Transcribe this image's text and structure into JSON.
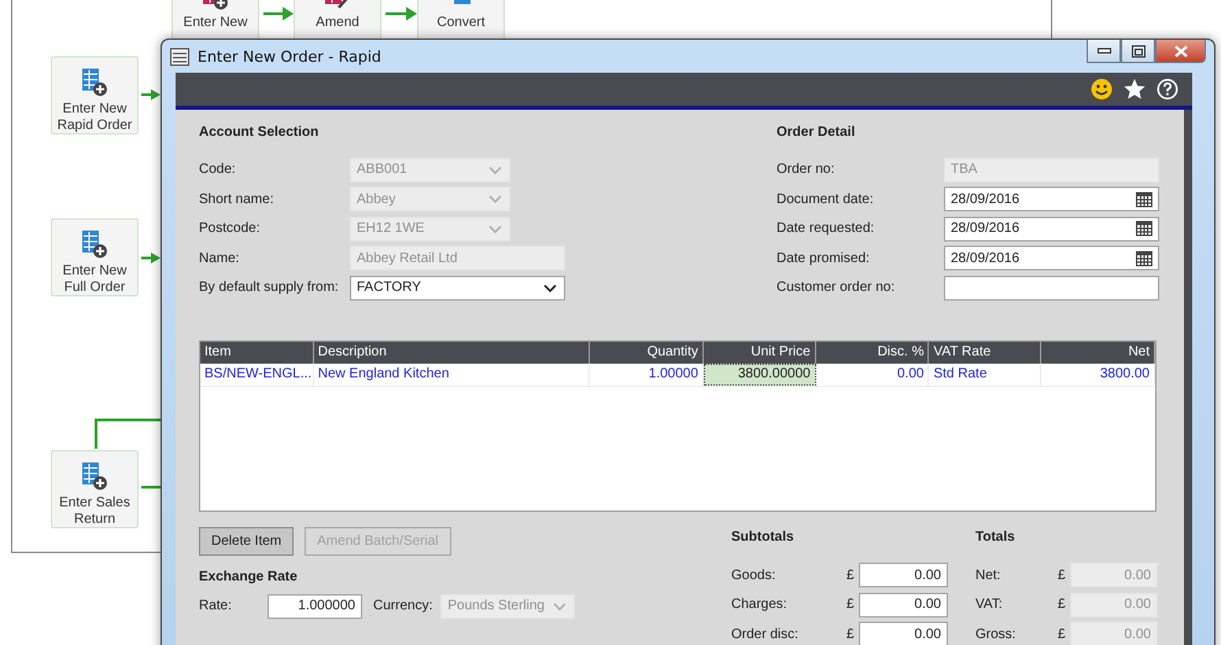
{
  "workflow": {
    "nodes": [
      {
        "label": "Enter New"
      },
      {
        "label": "Amend"
      },
      {
        "label": "Convert"
      },
      {
        "label": "Enter New Rapid Order"
      },
      {
        "label": "Enter New Full Order"
      },
      {
        "label": "Enter Sales Return"
      }
    ]
  },
  "window": {
    "title": "Enter New Order - Rapid"
  },
  "account_selection": {
    "heading": "Account Selection",
    "fields": [
      {
        "label": "Code:",
        "value": "ABB001",
        "kind": "combo",
        "disabled": true
      },
      {
        "label": "Short name:",
        "value": "Abbey",
        "kind": "combo",
        "disabled": true
      },
      {
        "label": "Postcode:",
        "value": "EH12 1WE",
        "kind": "combo",
        "disabled": true
      },
      {
        "label": "Name:",
        "value": "Abbey Retail Ltd",
        "kind": "text",
        "disabled": true
      },
      {
        "label": "By default supply from:",
        "value": "FACTORY",
        "kind": "select",
        "disabled": false
      }
    ]
  },
  "order_detail": {
    "heading": "Order Detail",
    "fields": [
      {
        "label": "Order no:",
        "value": "TBA",
        "kind": "text",
        "disabled": true
      },
      {
        "label": "Document date:",
        "value": "28/09/2016",
        "kind": "date",
        "disabled": false
      },
      {
        "label": "Date requested:",
        "value": "28/09/2016",
        "kind": "date",
        "disabled": false
      },
      {
        "label": "Date promised:",
        "value": "28/09/2016",
        "kind": "date",
        "disabled": false
      },
      {
        "label": "Customer order no:",
        "kind": "text",
        "disabled": false
      }
    ]
  },
  "table": {
    "columns": [
      {
        "label": "Item"
      },
      {
        "label": "Description"
      },
      {
        "label": "Quantity"
      },
      {
        "label": "Unit Price"
      },
      {
        "label": "Disc. %"
      },
      {
        "label": "VAT Rate"
      },
      {
        "label": "Net"
      }
    ],
    "rows": [
      {
        "cells": [
          {
            "text": "BS/NEW-ENGL...",
            "selected": false
          },
          {
            "text": "New England Kitchen",
            "selected": false
          },
          {
            "text": "1.00000",
            "selected": false
          },
          {
            "text": "3800.00000",
            "selected": true
          },
          {
            "text": "0.00",
            "selected": false
          },
          {
            "text": "Std Rate",
            "selected": false
          },
          {
            "text": "3800.00",
            "selected": false
          }
        ]
      }
    ]
  },
  "buttons": [
    {
      "label": "Delete Item",
      "disabled": false
    },
    {
      "label": "Amend Batch/Serial",
      "disabled": true
    }
  ],
  "exchange_rate": {
    "heading": "Exchange Rate",
    "rate_label": "Rate:",
    "rate": "1.000000",
    "currency_label": "Currency:",
    "currency": "Pounds Sterling",
    "currency_disabled": true
  },
  "subtotals": {
    "heading": "Subtotals",
    "rows": [
      {
        "label": "Goods:",
        "symbol": "£",
        "value": "0.00",
        "disabled": false
      },
      {
        "label": "Charges:",
        "symbol": "£",
        "value": "0.00",
        "disabled": false
      },
      {
        "label": "Order disc:",
        "symbol": "£",
        "value": "0.00",
        "disabled": false
      }
    ]
  },
  "totals": {
    "heading": "Totals",
    "rows": [
      {
        "label": "Net:",
        "symbol": "£",
        "value": "0.00",
        "disabled": true
      },
      {
        "label": "VAT:",
        "symbol": "£",
        "value": "0.00",
        "disabled": true
      },
      {
        "label": "Gross:",
        "symbol": "£",
        "value": "0.00",
        "disabled": true
      }
    ]
  }
}
